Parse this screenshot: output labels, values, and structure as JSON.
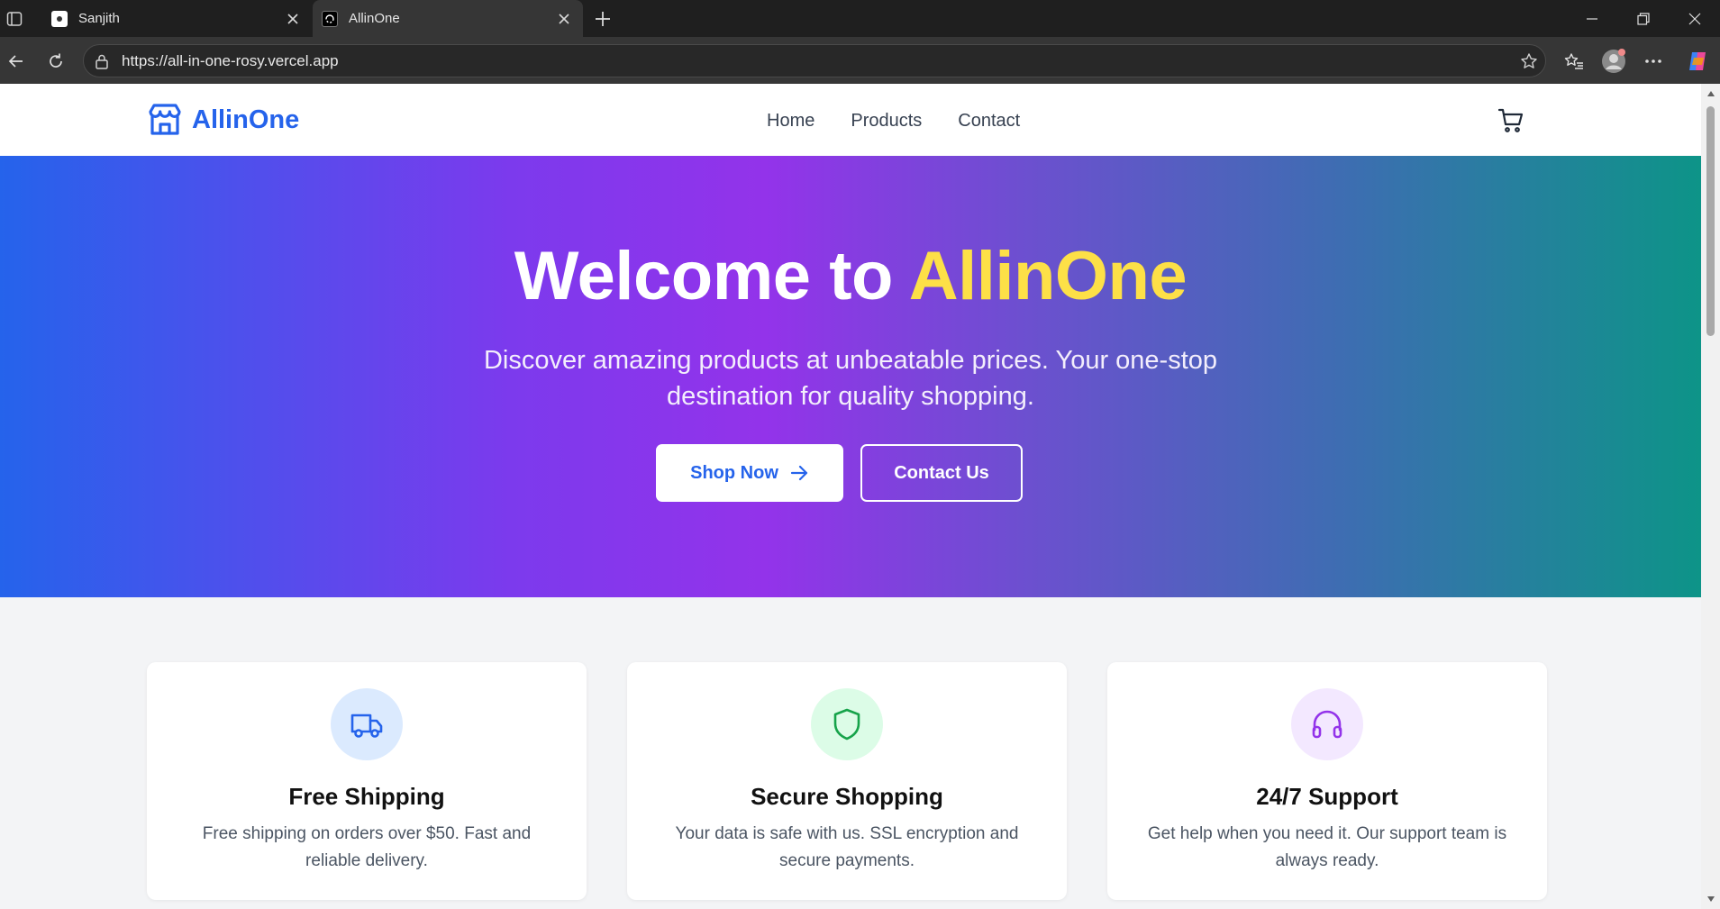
{
  "browser": {
    "tabs": [
      {
        "title": "Sanjith",
        "active": false
      },
      {
        "title": "AllinOne",
        "active": true
      }
    ],
    "url": "https://all-in-one-rosy.vercel.app"
  },
  "site": {
    "brand": "AllinOne",
    "nav": [
      "Home",
      "Products",
      "Contact"
    ],
    "hero": {
      "title_prefix": "Welcome to ",
      "title_accent": "AllinOne",
      "subtitle": "Discover amazing products at unbeatable prices. Your one-stop destination for quality shopping.",
      "primary_cta": "Shop Now",
      "secondary_cta": "Contact Us"
    },
    "features": [
      {
        "title": "Free Shipping",
        "description": "Free shipping on orders over $50. Fast and reliable delivery.",
        "icon": "truck-icon"
      },
      {
        "title": "Secure Shopping",
        "description": "Your data is safe with us. SSL encryption and secure payments.",
        "icon": "shield-icon"
      },
      {
        "title": "24/7 Support",
        "description": "Get help when you need it. Our support team is always ready.",
        "icon": "headphones-icon"
      }
    ]
  },
  "colors": {
    "brand": "#2563eb",
    "accent_yellow": "#fde047",
    "hero_gradient": [
      "#2563eb",
      "#9333ea",
      "#0d9488"
    ]
  }
}
